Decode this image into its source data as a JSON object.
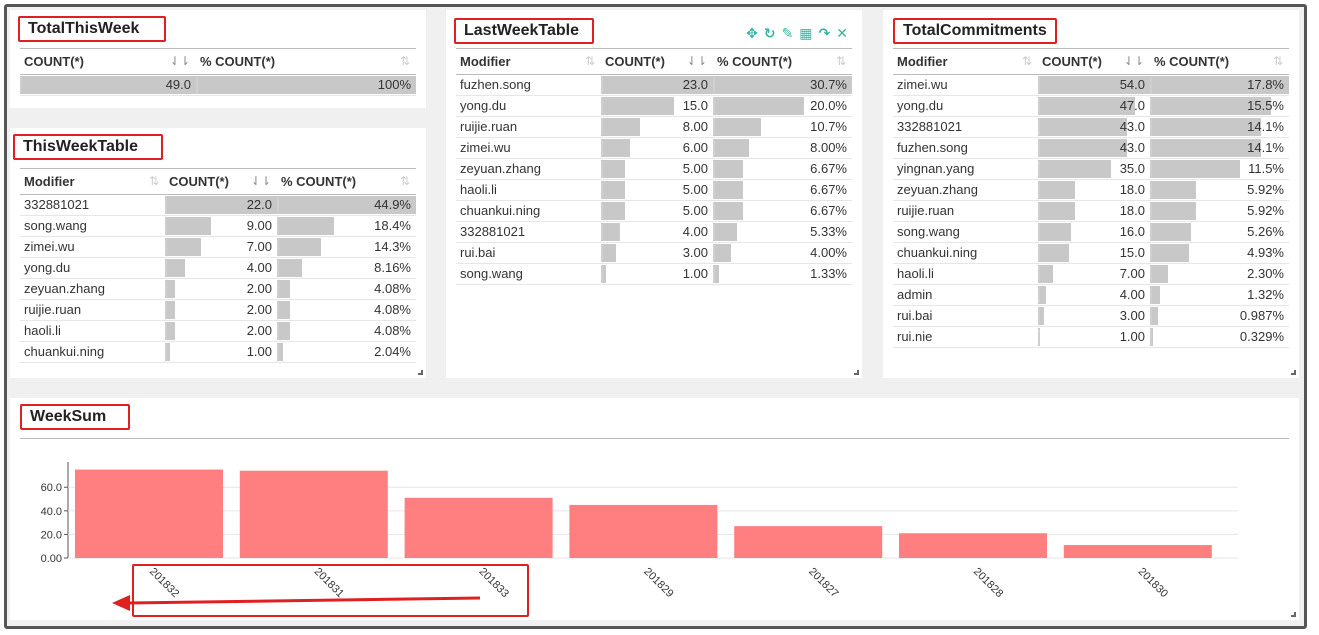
{
  "colors": {
    "accent": "#3bb3a3",
    "bar": "#ff7f80",
    "highlight": "#e02020",
    "cellbar": "#c8c8c8"
  },
  "total_this_week": {
    "title": "TotalThisWeek",
    "columns": [
      "COUNT(*)",
      "% COUNT(*)"
    ],
    "rows": [
      {
        "count": "49.0",
        "pct": "100%",
        "frac": 1.0,
        "pfrac": 1.0
      }
    ]
  },
  "this_week_table": {
    "title": "ThisWeekTable",
    "columns": [
      "Modifier",
      "COUNT(*)",
      "% COUNT(*)"
    ],
    "rows": [
      {
        "name": "332881021",
        "count": "22.0",
        "pct": "44.9%",
        "frac": 1.0
      },
      {
        "name": "song.wang",
        "count": "9.00",
        "pct": "18.4%",
        "frac": 0.409
      },
      {
        "name": "zimei.wu",
        "count": "7.00",
        "pct": "14.3%",
        "frac": 0.318
      },
      {
        "name": "yong.du",
        "count": "4.00",
        "pct": "8.16%",
        "frac": 0.182
      },
      {
        "name": "zeyuan.zhang",
        "count": "2.00",
        "pct": "4.08%",
        "frac": 0.091
      },
      {
        "name": "ruijie.ruan",
        "count": "2.00",
        "pct": "4.08%",
        "frac": 0.091
      },
      {
        "name": "haoli.li",
        "count": "2.00",
        "pct": "4.08%",
        "frac": 0.091
      },
      {
        "name": "chuankui.ning",
        "count": "1.00",
        "pct": "2.04%",
        "frac": 0.045
      }
    ]
  },
  "last_week_table": {
    "title": "LastWeekTable",
    "toolbar": [
      "move-icon",
      "refresh-icon",
      "edit-icon",
      "table-icon",
      "share-icon",
      "close-icon"
    ],
    "columns": [
      "Modifier",
      "COUNT(*)",
      "% COUNT(*)"
    ],
    "rows": [
      {
        "name": "fuzhen.song",
        "count": "23.0",
        "pct": "30.7%",
        "frac": 1.0
      },
      {
        "name": "yong.du",
        "count": "15.0",
        "pct": "20.0%",
        "frac": 0.652
      },
      {
        "name": "ruijie.ruan",
        "count": "8.00",
        "pct": "10.7%",
        "frac": 0.348
      },
      {
        "name": "zimei.wu",
        "count": "6.00",
        "pct": "8.00%",
        "frac": 0.261
      },
      {
        "name": "zeyuan.zhang",
        "count": "5.00",
        "pct": "6.67%",
        "frac": 0.217
      },
      {
        "name": "haoli.li",
        "count": "5.00",
        "pct": "6.67%",
        "frac": 0.217
      },
      {
        "name": "chuankui.ning",
        "count": "5.00",
        "pct": "6.67%",
        "frac": 0.217
      },
      {
        "name": "332881021",
        "count": "4.00",
        "pct": "5.33%",
        "frac": 0.174
      },
      {
        "name": "rui.bai",
        "count": "3.00",
        "pct": "4.00%",
        "frac": 0.13
      },
      {
        "name": "song.wang",
        "count": "1.00",
        "pct": "1.33%",
        "frac": 0.043
      }
    ]
  },
  "total_commitments": {
    "title": "TotalCommitments",
    "columns": [
      "Modifier",
      "COUNT(*)",
      "% COUNT(*)"
    ],
    "rows": [
      {
        "name": "zimei.wu",
        "count": "54.0",
        "pct": "17.8%",
        "frac": 1.0
      },
      {
        "name": "yong.du",
        "count": "47.0",
        "pct": "15.5%",
        "frac": 0.87
      },
      {
        "name": "332881021",
        "count": "43.0",
        "pct": "14.1%",
        "frac": 0.796
      },
      {
        "name": "fuzhen.song",
        "count": "43.0",
        "pct": "14.1%",
        "frac": 0.796
      },
      {
        "name": "yingnan.yang",
        "count": "35.0",
        "pct": "11.5%",
        "frac": 0.648
      },
      {
        "name": "zeyuan.zhang",
        "count": "18.0",
        "pct": "5.92%",
        "frac": 0.333
      },
      {
        "name": "ruijie.ruan",
        "count": "18.0",
        "pct": "5.92%",
        "frac": 0.333
      },
      {
        "name": "song.wang",
        "count": "16.0",
        "pct": "5.26%",
        "frac": 0.296
      },
      {
        "name": "chuankui.ning",
        "count": "15.0",
        "pct": "4.93%",
        "frac": 0.278
      },
      {
        "name": "haoli.li",
        "count": "7.00",
        "pct": "2.30%",
        "frac": 0.13
      },
      {
        "name": "admin",
        "count": "4.00",
        "pct": "1.32%",
        "frac": 0.074
      },
      {
        "name": "rui.bai",
        "count": "3.00",
        "pct": "0.987%",
        "frac": 0.056
      },
      {
        "name": "rui.nie",
        "count": "1.00",
        "pct": "0.329%",
        "frac": 0.019
      }
    ]
  },
  "week_sum": {
    "title": "WeekSum"
  },
  "chart_data": {
    "type": "bar",
    "title": "WeekSum",
    "categories": [
      "201832",
      "201831",
      "201833",
      "201829",
      "201827",
      "201828",
      "201830"
    ],
    "values": [
      75,
      74,
      51,
      45,
      27,
      21,
      11
    ],
    "yticks": [
      "0.00",
      "20.0",
      "40.0",
      "60.0"
    ],
    "ylim": [
      0,
      78
    ],
    "grid": true,
    "color": "#ff7f80"
  }
}
